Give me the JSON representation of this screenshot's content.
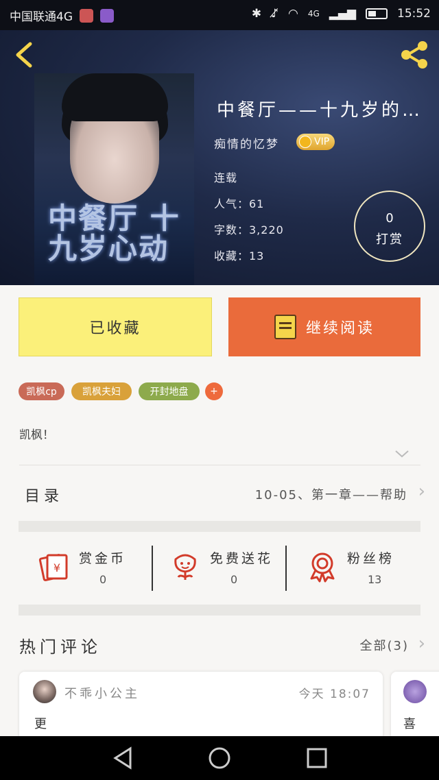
{
  "status_bar": {
    "carrier": "中国联通4G",
    "network": "4G",
    "time": "15:52"
  },
  "book": {
    "title": "中餐厅——十九岁的…",
    "cover_title": "中餐厅 十九岁心动",
    "author": "痴情的忆梦",
    "vip_label": "VIP",
    "status": "连载",
    "popularity": "人气：61",
    "word_count": "字数：3,220",
    "favorites": "收藏：13",
    "reward_count": "0",
    "reward_label": "打赏"
  },
  "actions": {
    "collected_label": "已收藏",
    "continue_label": "继续阅读"
  },
  "tags": [
    {
      "label": "凯枫cp",
      "color": "#c96a57"
    },
    {
      "label": "凯枫夫妇",
      "color": "#d9a13a"
    },
    {
      "label": "开封地盘",
      "color": "#8daa4c"
    },
    {
      "label": "+",
      "color": "#ee6a3c"
    }
  ],
  "summary": "凯枫！",
  "catalog": {
    "label": "目录",
    "latest": "10-05、第一章——帮助"
  },
  "stats": [
    {
      "label": "赏金币",
      "value": "0",
      "icon": "coin-envelope-icon"
    },
    {
      "label": "免费送花",
      "value": "0",
      "icon": "flower-icon"
    },
    {
      "label": "粉丝榜",
      "value": "13",
      "icon": "badge-icon"
    }
  ],
  "comments": {
    "title": "热门评论",
    "all_label": "全部(3)",
    "items": [
      {
        "user": "不乖小公主",
        "time": "今天 18:07",
        "text": "更"
      },
      {
        "user": "",
        "time": "",
        "text": "喜"
      }
    ]
  },
  "colors": {
    "accent_orange": "#ea6b3b",
    "collected_yellow": "#fbf07a",
    "back_yellow": "#f5d44b"
  }
}
